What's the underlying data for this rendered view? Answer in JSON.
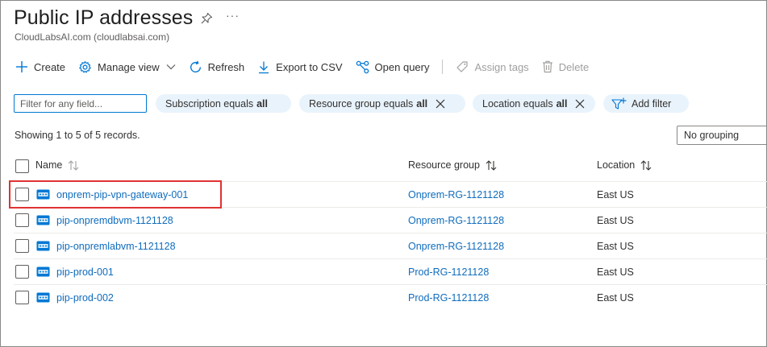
{
  "header": {
    "title": "Public IP addresses",
    "subtitle": "CloudLabsAI.com (cloudlabsai.com)",
    "pin_icon": "pin-icon",
    "more_label": "···"
  },
  "toolbar": {
    "create": "Create",
    "manage_view": "Manage view",
    "refresh": "Refresh",
    "export_csv": "Export to CSV",
    "open_query": "Open query",
    "assign_tags": "Assign tags",
    "delete": "Delete"
  },
  "filters": {
    "placeholder": "Filter for any field...",
    "subscription": {
      "label": "Subscription equals",
      "value": "all"
    },
    "resource_group": {
      "label": "Resource group equals",
      "value": "all"
    },
    "location": {
      "label": "Location equals",
      "value": "all"
    },
    "add_filter": "Add filter"
  },
  "records_text": "Showing 1 to 5 of 5 records.",
  "grouping": "No grouping",
  "columns": {
    "name": "Name",
    "resource_group": "Resource group",
    "location": "Location"
  },
  "rows": [
    {
      "name": "onprem-pip-vpn-gateway-001",
      "resource_group": "Onprem-RG-1121128",
      "location": "East US"
    },
    {
      "name": "pip-onpremdbvm-1121128",
      "resource_group": "Onprem-RG-1121128",
      "location": "East US"
    },
    {
      "name": "pip-onpremlabvm-1121128",
      "resource_group": "Onprem-RG-1121128",
      "location": "East US"
    },
    {
      "name": "pip-prod-001",
      "resource_group": "Prod-RG-1121128",
      "location": "East US"
    },
    {
      "name": "pip-prod-002",
      "resource_group": "Prod-RG-1121128",
      "location": "East US"
    }
  ],
  "colors": {
    "accent": "#0078d4",
    "link": "#0f6cbd",
    "pill_bg": "#e9f3fc",
    "highlight": "#e03232"
  }
}
